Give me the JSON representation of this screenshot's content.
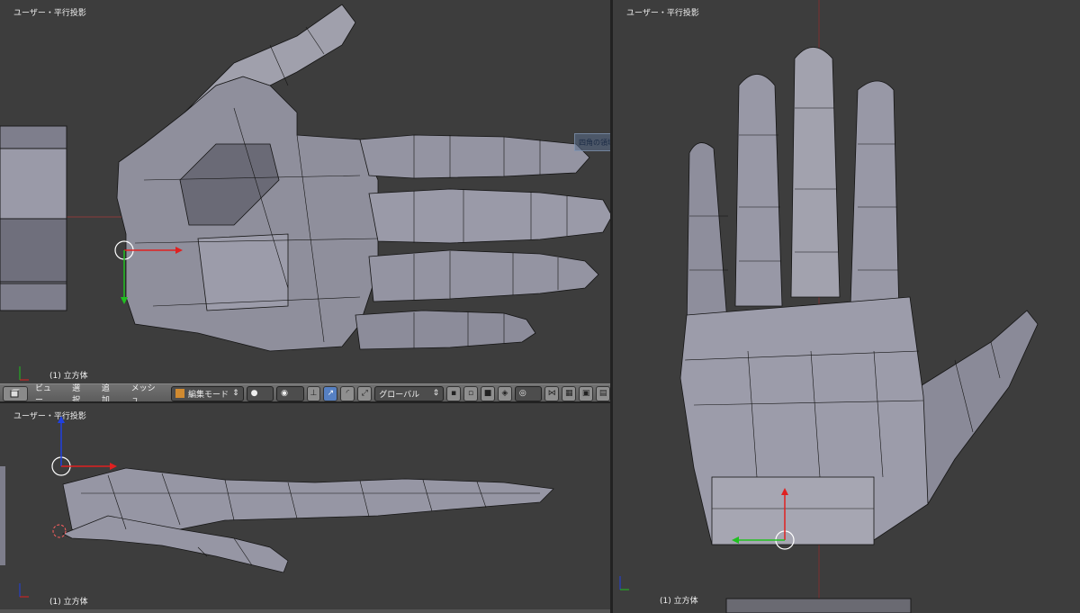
{
  "viewports": {
    "top": {
      "title": "ユーザー・平行投影",
      "object_label": "(1) 立方体"
    },
    "bottom": {
      "title": "ユーザー・平行投影",
      "object_label": "(1) 立方体"
    },
    "right": {
      "title": "ユーザー・平行投影",
      "object_label": "(1) 立方体"
    }
  },
  "header": {
    "menu": [
      "ビュー",
      "選択",
      "追加",
      "メッシュ"
    ],
    "mode": "編集モード",
    "orientation": "グローバル"
  },
  "tooltip": {
    "text": "四角の領域切り取り(K)"
  },
  "colors": {
    "x_axis": "#e02020",
    "y_axis": "#20c020",
    "z_axis": "#2040e0",
    "mesh": "#9898a6",
    "wire": "#1a1a1a",
    "background": "#3d3d3d"
  },
  "icons": [
    "cube-icon",
    "sphere-icon",
    "pivot-icon",
    "translate-icon",
    "rotate-icon",
    "scale-icon",
    "vertex-icon",
    "edge-icon",
    "face-icon",
    "snap-icon",
    "render-icon"
  ]
}
